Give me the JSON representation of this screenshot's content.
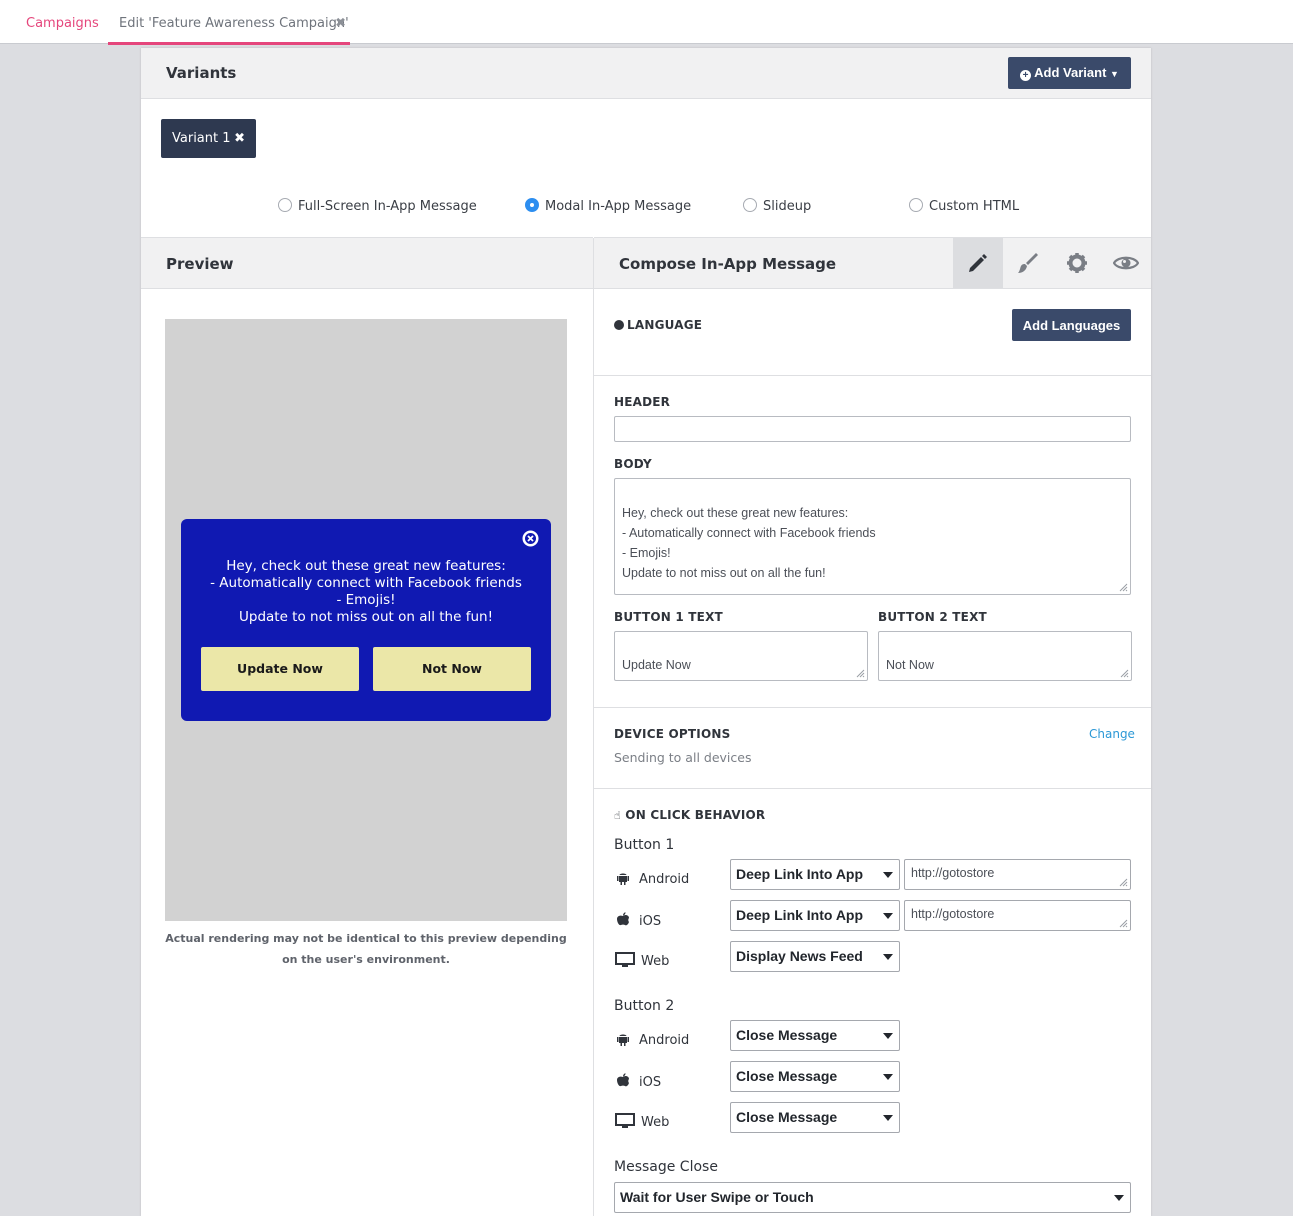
{
  "tabs": {
    "campaigns": "Campaigns",
    "edit": "Edit 'Feature Awareness Campaign'"
  },
  "variants": {
    "title": "Variants",
    "add_variant": "Add Variant",
    "variant_pill": "Variant 1",
    "types": [
      "Full-Screen In-App Message",
      "Modal In-App Message",
      "Slideup",
      "Custom HTML"
    ],
    "selected_type": "Modal In-App Message"
  },
  "preview": {
    "title": "Preview",
    "body": "Hey, check out these great new features:\n- Automatically connect with Facebook friends\n- Emojis!\nUpdate to not miss out on all the fun!",
    "button1": "Update Now",
    "button2": "Not Now",
    "disclaimer": "Actual rendering may not be identical to this preview depending on the user's environment."
  },
  "compose": {
    "title": "Compose In-App Message",
    "language_label": "LANGUAGE",
    "add_languages": "Add Languages",
    "header_label": "HEADER",
    "header_value": "",
    "body_label": "BODY",
    "body_value": "Hey, check out these great new features:\n- Automatically connect with Facebook friends\n- Emojis!\nUpdate to not miss out on all the fun!",
    "button1_label": "BUTTON 1 TEXT",
    "button1_value": "Update Now",
    "button2_label": "BUTTON 2 TEXT",
    "button2_value": "Not Now",
    "device_label": "DEVICE OPTIONS",
    "device_change": "Change",
    "device_value": "Sending to all devices",
    "onclick_label": "ON CLICK BEHAVIOR",
    "b1_title": "Button 1",
    "b2_title": "Button 2",
    "android": "Android",
    "ios": "iOS",
    "web": "Web",
    "b1_android": "Deep Link Into App",
    "b1_android_url": "http://gotostore",
    "b1_ios": "Deep Link Into App",
    "b1_ios_url": "http://gotostore",
    "b1_web": "Display News Feed",
    "b2_android": "Close Message",
    "b2_ios": "Close Message",
    "b2_web": "Close Message",
    "message_close_label": "Message Close",
    "message_close_value": "Wait for User Swipe or Touch"
  },
  "colors": {
    "accent": "#e5467c",
    "dark_button": "#3a4a6a",
    "modal_bg": "#1019b2",
    "modal_button": "#ebe7a8",
    "link": "#2b98d6"
  }
}
